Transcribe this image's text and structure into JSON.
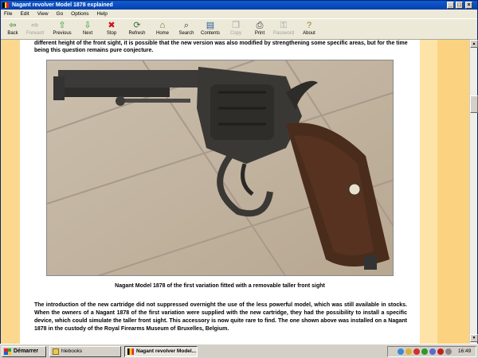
{
  "window": {
    "title": "Nagant revolver Model 1878 explained",
    "controls": [
      "_",
      "□",
      "X"
    ]
  },
  "menu": [
    "File",
    "Edit",
    "View",
    "Go",
    "Options",
    "Help"
  ],
  "toolbar": [
    {
      "label": "Back",
      "icon": "arrow-left-icon",
      "glyph": "⇦",
      "color": "#2a7a2a",
      "enabled": true
    },
    {
      "label": "Forward",
      "icon": "arrow-right-icon",
      "glyph": "⇨",
      "color": "#a0a0a0",
      "enabled": false
    },
    {
      "label": "Previous",
      "icon": "arrow-up-icon",
      "glyph": "⇧",
      "color": "#2a9a2a",
      "enabled": true
    },
    {
      "label": "Next",
      "icon": "arrow-down-icon",
      "glyph": "⇩",
      "color": "#2a9a2a",
      "enabled": true
    },
    {
      "label": "Stop",
      "icon": "stop-icon",
      "glyph": "✖",
      "color": "#cc1111",
      "enabled": true
    },
    {
      "label": "Refresh",
      "icon": "refresh-icon",
      "glyph": "⟳",
      "color": "#3a6a3a",
      "enabled": true
    },
    {
      "label": "Home",
      "icon": "home-icon",
      "glyph": "⌂",
      "color": "#7a5a2a",
      "enabled": true
    },
    {
      "label": "Search",
      "icon": "search-icon",
      "glyph": "⌕",
      "color": "#333333",
      "enabled": true
    },
    {
      "label": "Contents",
      "icon": "contents-icon",
      "glyph": "▤",
      "color": "#2a5a9a",
      "enabled": true
    },
    {
      "label": "Copy",
      "icon": "copy-icon",
      "glyph": "❐",
      "color": "#a0a0a0",
      "enabled": false
    },
    {
      "label": "Print",
      "icon": "print-icon",
      "glyph": "⎙",
      "color": "#333333",
      "enabled": true
    },
    {
      "label": "Password",
      "icon": "password-icon",
      "glyph": "⚿",
      "color": "#a0a0a0",
      "enabled": false
    },
    {
      "label": "About",
      "icon": "about-icon",
      "glyph": "?",
      "color": "#9a7a2a",
      "enabled": true
    }
  ],
  "article": {
    "top_text": "different height of the front sight, it is possible that the new version was also modified by strengthening some specific areas, but for the time being this question remains pure conjecture.",
    "caption": "Nagant Model 1878 of the first variation fitted with a removable taller front sight",
    "paragraph": "The introduction of the new cartridge did not suppressed overnight the use of the less powerful model, which was still available in stocks. When the owners of a Nagant 1878 of the first variation were supplied with the new cartridge, they had the possibility to install a specific device, which could simulate the taller front sight. This accessory is now quite rare to find. The one shown above was installed on a Nagant 1878 in the custody of the Royal Firearms Museum of Bruxelles, Belgium."
  },
  "taskbar": {
    "start_label": "Démarrer",
    "tasks": [
      {
        "label": "hlebooks",
        "active": false
      },
      {
        "label": "Nagant revolver Model...",
        "active": true
      }
    ],
    "clock": "16:49"
  },
  "colors": {
    "page_band_left": "#fbd88e",
    "page_band_right": "#fde3a8",
    "title_bar": "#0a3fa8"
  }
}
